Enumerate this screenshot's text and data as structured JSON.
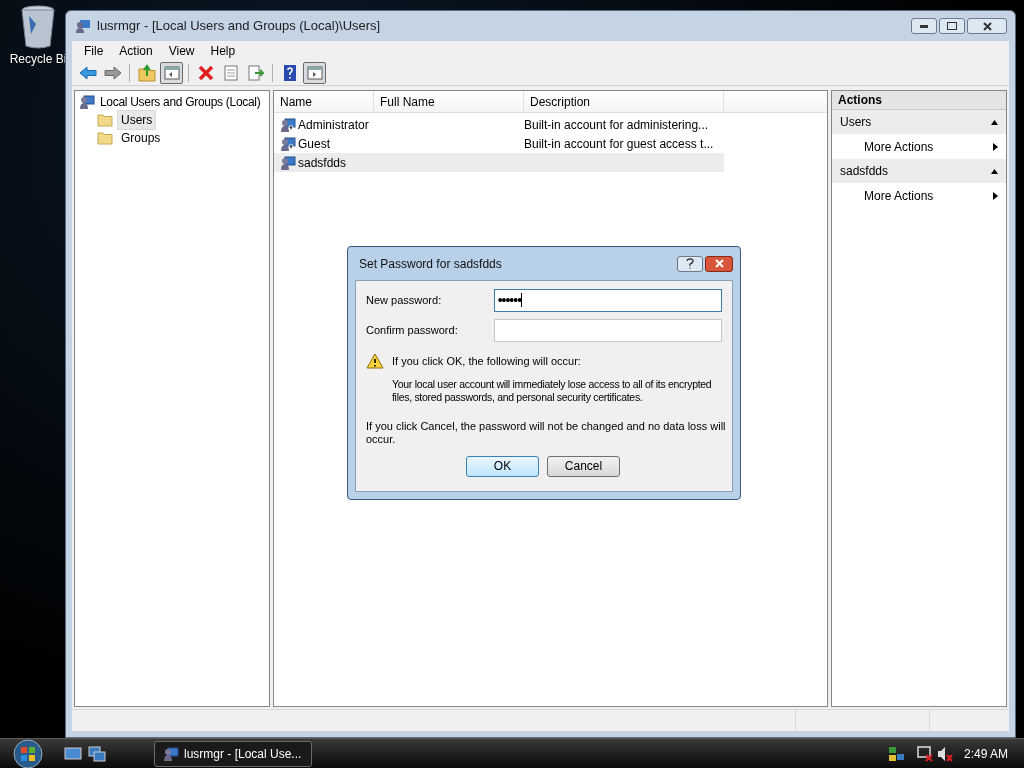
{
  "desktop": {
    "icons": [
      {
        "label": "Recycle Bi"
      }
    ]
  },
  "window": {
    "title": "lusrmgr - [Local Users and Groups (Local)\\Users]",
    "menu": [
      "File",
      "Action",
      "View",
      "Help"
    ],
    "toolbar": [
      {
        "kind": "back",
        "pressed": false
      },
      {
        "kind": "forward",
        "pressed": false
      },
      {
        "kind": "up",
        "pressed": false
      },
      {
        "kind": "tree",
        "pressed": true
      },
      {
        "kind": "delete",
        "pressed": false
      },
      {
        "kind": "properties",
        "pressed": false
      },
      {
        "kind": "export",
        "pressed": false
      },
      {
        "kind": "help",
        "pressed": false
      },
      {
        "kind": "action-pane",
        "pressed": true
      }
    ],
    "tree": {
      "label": "Local Users and Groups (Local)",
      "children": [
        {
          "label": "Users",
          "selected": true
        },
        {
          "label": "Groups",
          "selected": false
        }
      ]
    },
    "list": {
      "columns": [
        "Name",
        "Full Name",
        "Description"
      ],
      "rows": [
        {
          "name": "Administrator",
          "description": "Built-in account for administering...",
          "disabled": true,
          "selected": false
        },
        {
          "name": "Guest",
          "description": "Built-in account for guest access t...",
          "disabled": true,
          "selected": false
        },
        {
          "name": "sadsfdds",
          "disabled": false,
          "selected": true
        }
      ]
    },
    "actions": {
      "title": "Actions",
      "groups": [
        {
          "title": "Users",
          "expanded": true,
          "items": [
            "More Actions"
          ]
        },
        {
          "title": "sadsfdds",
          "expanded": true,
          "items": [
            "More Actions"
          ]
        }
      ]
    }
  },
  "dialog": {
    "title": "Set Password for sadsfdds",
    "fields": [
      {
        "label": "New password:",
        "value": "••••••",
        "focused": true
      },
      {
        "label": "Confirm password:",
        "focused": false
      }
    ],
    "warning_heading": "If you click OK, the following will occur:",
    "warning_body": "Your local user account will immediately lose access to all of its encrypted files, stored passwords, and personal security certificates.",
    "note": "If you click Cancel, the password will not be changed and no data loss will occur.",
    "buttons": [
      {
        "label": "OK",
        "default": true
      },
      {
        "label": "Cancel",
        "default": false
      }
    ]
  },
  "taskbar": {
    "tasks": [
      {
        "label": "lusrmgr - [Local Use...",
        "selected": false
      }
    ],
    "clock": "2:49 AM"
  }
}
